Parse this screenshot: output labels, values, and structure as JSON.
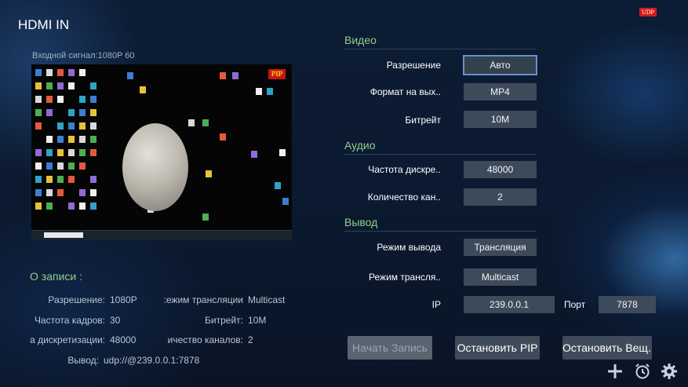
{
  "header": {
    "title": "HDMI IN",
    "udp_badge": "UDP"
  },
  "preview": {
    "signal_text": "Входной сигнал:1080P   60",
    "pip_badge": "PIP"
  },
  "record_info": {
    "title": "О записи :",
    "rows": [
      {
        "label": "Разрешение:",
        "value": "1080P",
        "label2": "ежим трансляции:",
        "value2": "Multicast"
      },
      {
        "label": "Частота кадров:",
        "value": "30",
        "label2": "Битрейт:",
        "value2": "10M"
      },
      {
        "label": "а дискретизации:",
        "value": "48000",
        "label2": "ичество каналов:",
        "value2": "2"
      }
    ],
    "output_label": "Вывод:",
    "output_value": "udp://@239.0.0.1:7878"
  },
  "video": {
    "section": "Видео",
    "resolution_label": "Разрешение",
    "resolution_value": "Авто",
    "format_label": "Формат на вых..",
    "format_value": "MP4",
    "bitrate_label": "Битрейт",
    "bitrate_value": "10M"
  },
  "audio": {
    "section": "Аудио",
    "samplerate_label": "Частота дискре..",
    "samplerate_value": "48000",
    "channels_label": "Количество кан..",
    "channels_value": "2"
  },
  "output": {
    "section": "Вывод",
    "mode_label": "Режим вывода",
    "mode_value": "Трансляция",
    "broadcast_label": "Режим трансля..",
    "broadcast_value": "Multicast",
    "ip_label": "IP",
    "ip_value": "239.0.0.1",
    "port_label": "Порт",
    "port_value": "7878"
  },
  "buttons": {
    "start_record": "Начать Запись",
    "stop_pip": "Остановить PIP",
    "stop_broadcast": "Остановить Вещ.."
  },
  "icons": {
    "add": "plus-icon",
    "alarm": "alarm-clock-icon",
    "settings": "gear-icon"
  },
  "colors": {
    "section_green": "#8fd18a",
    "background": "#0b1a30",
    "badge_red": "#d21b1b"
  }
}
